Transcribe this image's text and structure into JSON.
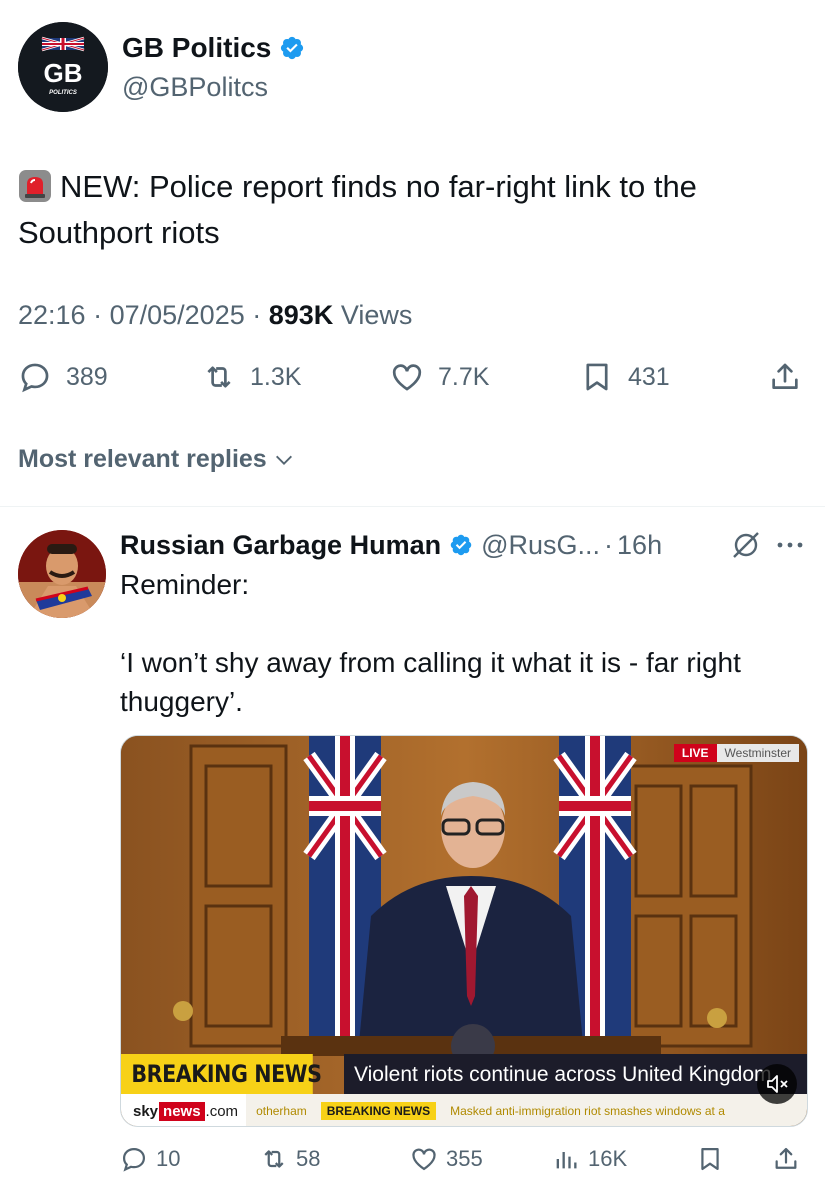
{
  "tweet": {
    "author_name": "GB Politics",
    "author_handle": "@GBPolitcs",
    "avatar_text": "GB",
    "avatar_subtext": "POLITICS",
    "text": "NEW: Police report finds no far-right link to the Southport riots",
    "time": "22:16",
    "date": "07/05/2025",
    "views_count": "893K",
    "views_label": "Views",
    "replies": "389",
    "reposts": "1.3K",
    "likes": "7.7K",
    "bookmarks": "431"
  },
  "replies_header": "Most relevant replies",
  "reply": {
    "author_name": "Russian Garbage Human",
    "author_handle": "@RusG...",
    "time": "16h",
    "text_line1": "Reminder:",
    "text_line2": "‘I won’t shy away from calling it what it is - far right thuggery’.",
    "media": {
      "live_label": "LIVE",
      "location": "Westminster",
      "breaking_label": "BREAKING NEWS",
      "headline": "Violent riots continue across United Kingdom",
      "sky_brand": "sky",
      "sky_news": "news",
      "sky_com": ".com",
      "ticker_1": "otherham",
      "ticker_2": "BREAKING NEWS",
      "ticker_3": "Masked anti-immigration riot smashes windows at a"
    },
    "replies": "10",
    "reposts": "58",
    "likes": "355",
    "views": "16K"
  },
  "colors": {
    "verified_blue": "#1d9bf0",
    "secondary_text": "#536471",
    "primary_text": "#0f1419",
    "breaking_yellow": "#f7d117",
    "live_red": "#d0021b"
  },
  "icons": [
    "siren-icon",
    "verified-badge-icon",
    "reply-icon",
    "repost-icon",
    "like-icon",
    "bookmark-icon",
    "share-icon",
    "chevron-down-icon",
    "grok-icon",
    "more-icon",
    "views-icon",
    "mute-icon"
  ]
}
